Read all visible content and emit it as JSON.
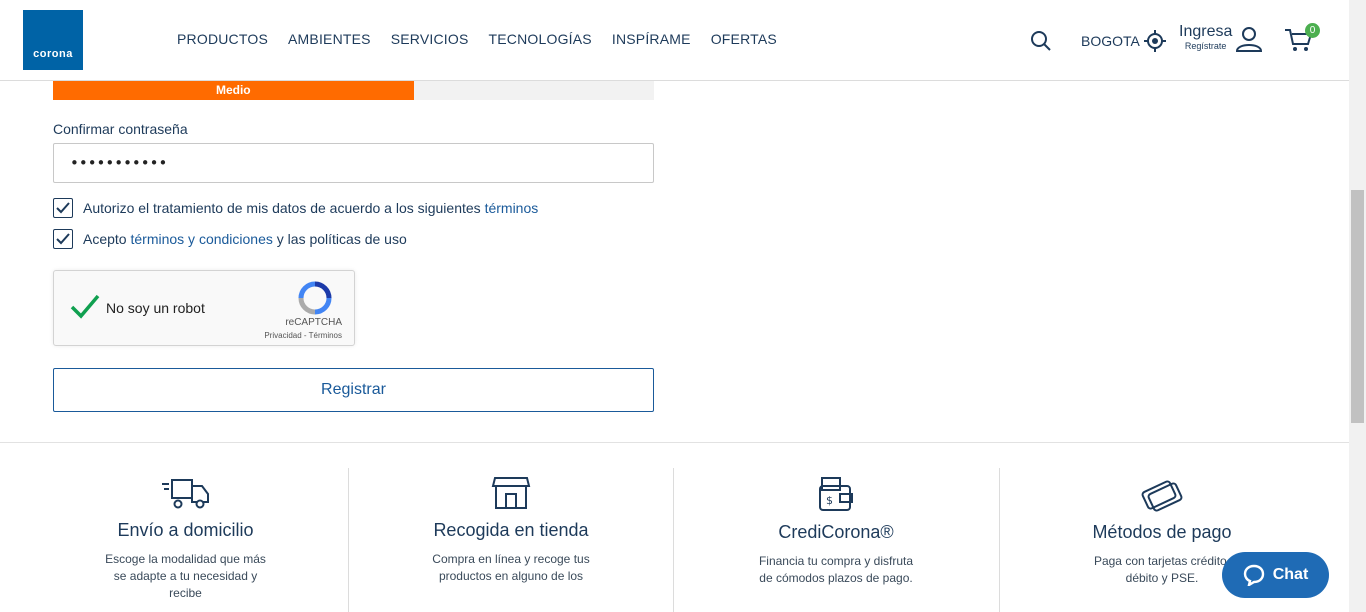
{
  "header": {
    "logo_text": "corona",
    "nav": [
      "PRODUCTOS",
      "AMBIENTES",
      "SERVICIOS",
      "TECNOLOGÍAS",
      "INSPÍRAME",
      "OFERTAS"
    ],
    "city": "BOGOTA",
    "login_label": "Ingresa",
    "register_label": "Regístrate",
    "cart_count": "0"
  },
  "form": {
    "strength_label": "Medio",
    "strength_percent": 60,
    "confirm_label": "Confirmar contraseña",
    "confirm_value": "•••••••••••",
    "check1_text": "Autorizo el tratamiento de mis datos de acuerdo a los siguientes ",
    "check1_link": "términos",
    "check2_prefix": "Acepto ",
    "check2_link": "términos y condiciones",
    "check2_suffix": " y las políticas de uso",
    "recaptcha_text": "No soy un robot",
    "recaptcha_brand": "reCAPTCHA",
    "recaptcha_links": "Privacidad - Términos",
    "register_button": "Registrar"
  },
  "features": [
    {
      "title": "Envío a domicilio",
      "desc": "Escoge la modalidad que más se adapte a tu necesidad y recibe",
      "icon": "truck-icon"
    },
    {
      "title": "Recogida en tienda",
      "desc": "Compra en línea y recoge tus productos en alguno de los",
      "icon": "store-icon"
    },
    {
      "title": "CrediCorona®",
      "desc": "Financia tu compra y disfruta de cómodos plazos de pago.",
      "icon": "wallet-icon"
    },
    {
      "title": "Métodos de pago",
      "desc": "Paga con tarjetas crédito, débito y PSE.",
      "icon": "cards-icon"
    }
  ],
  "chat_label": "Chat",
  "colors": {
    "brand": "#0063a6",
    "strength": "#ff6b00",
    "badge": "#4caf50",
    "chat": "#1f6bb5"
  }
}
